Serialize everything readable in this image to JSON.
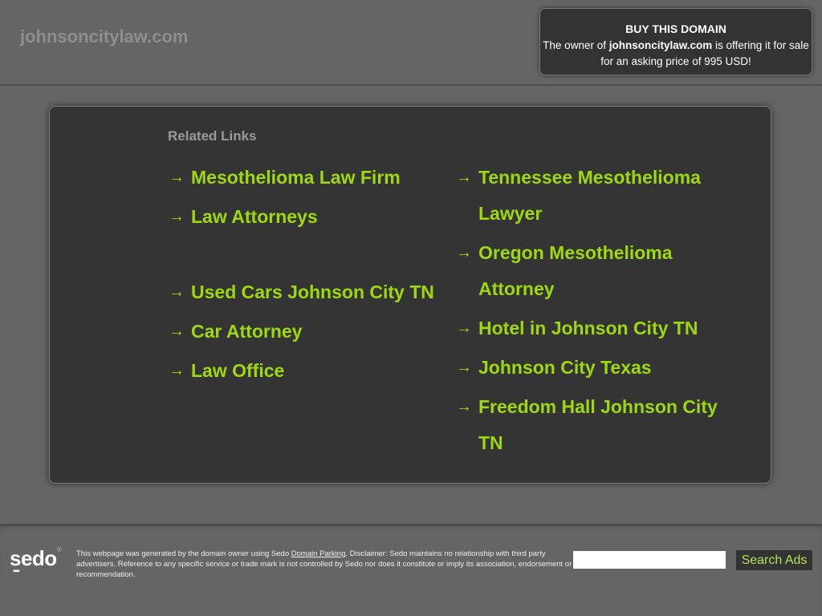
{
  "header": {
    "site_title": "johnsoncitylaw.com"
  },
  "buy_box": {
    "title": "BUY THIS DOMAIN",
    "text_prefix": "The owner of ",
    "domain": "johnsoncitylaw.com",
    "text_suffix": " is offering it for sale for an asking price of 995 USD!"
  },
  "related": {
    "title": "Related Links",
    "arrow_icon": "→",
    "left": [
      "Mesothelioma Law Firm",
      "Law Attorneys",
      "Used Cars Johnson City TN",
      "Car Attorney",
      "Law Office"
    ],
    "right": [
      "Tennessee Mesothelioma Lawyer",
      "Oregon Mesothelioma Attorney",
      "Hotel in Johnson City TN",
      "Johnson City Texas",
      "Freedom Hall Johnson City TN"
    ]
  },
  "footer": {
    "logo_text": "sedo",
    "logo_mark": "®",
    "disclaimer_prefix": "This webpage was generated by the domain owner using Sedo ",
    "disclaimer_link": "Domain Parking",
    "disclaimer_suffix": ". Disclaimer: Sedo maintains no relationship with third party advertisers. Reference to any specific service or trade mark is not controlled by Sedo nor does it constitute or imply its association, endorsement or recommendation.",
    "search_placeholder": "",
    "search_button": "Search Ads"
  },
  "colors": {
    "link": "#9ed80e",
    "background": "#656565",
    "panel": "#343434"
  }
}
